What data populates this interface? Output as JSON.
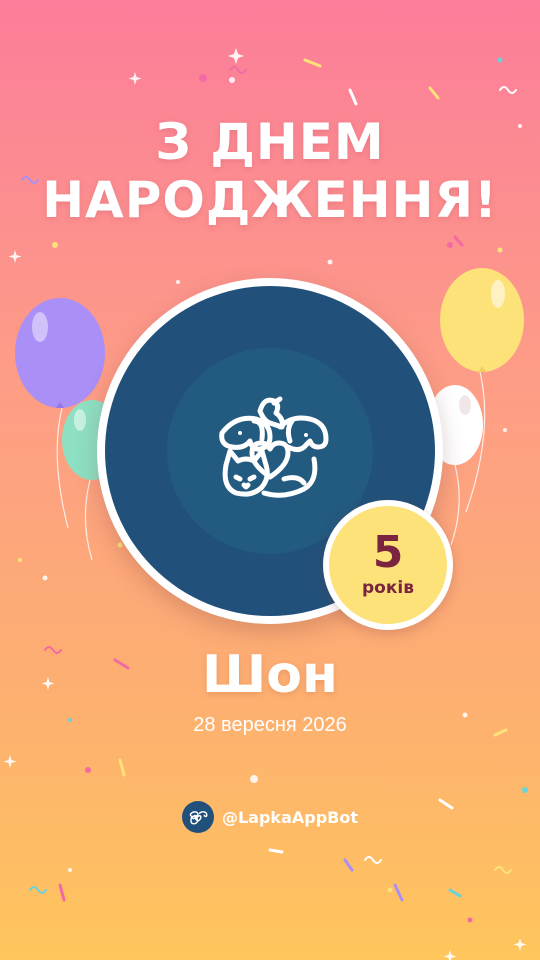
{
  "card": {
    "title_line1": "З ДНЕМ",
    "title_line2": "НАРОДЖЕННЯ!",
    "age_number": "5",
    "age_unit": "років",
    "pet_name": "Шон",
    "date": "28 вересня 2026",
    "bot_handle": "@LapkaAppBot"
  },
  "colors": {
    "background_top": "#fb7d9a",
    "background_bottom": "#fec65c",
    "circle": "#21517a",
    "badge": "#fde27a",
    "badge_text": "#7a2440",
    "balloon_purple": "#a98ff6",
    "balloon_teal": "#8ee0c3",
    "balloon_yellow": "#fde27a",
    "balloon_white": "#ffffff"
  },
  "icons": {
    "main": "pets-heart-icon",
    "footer": "pets-logo-icon"
  }
}
